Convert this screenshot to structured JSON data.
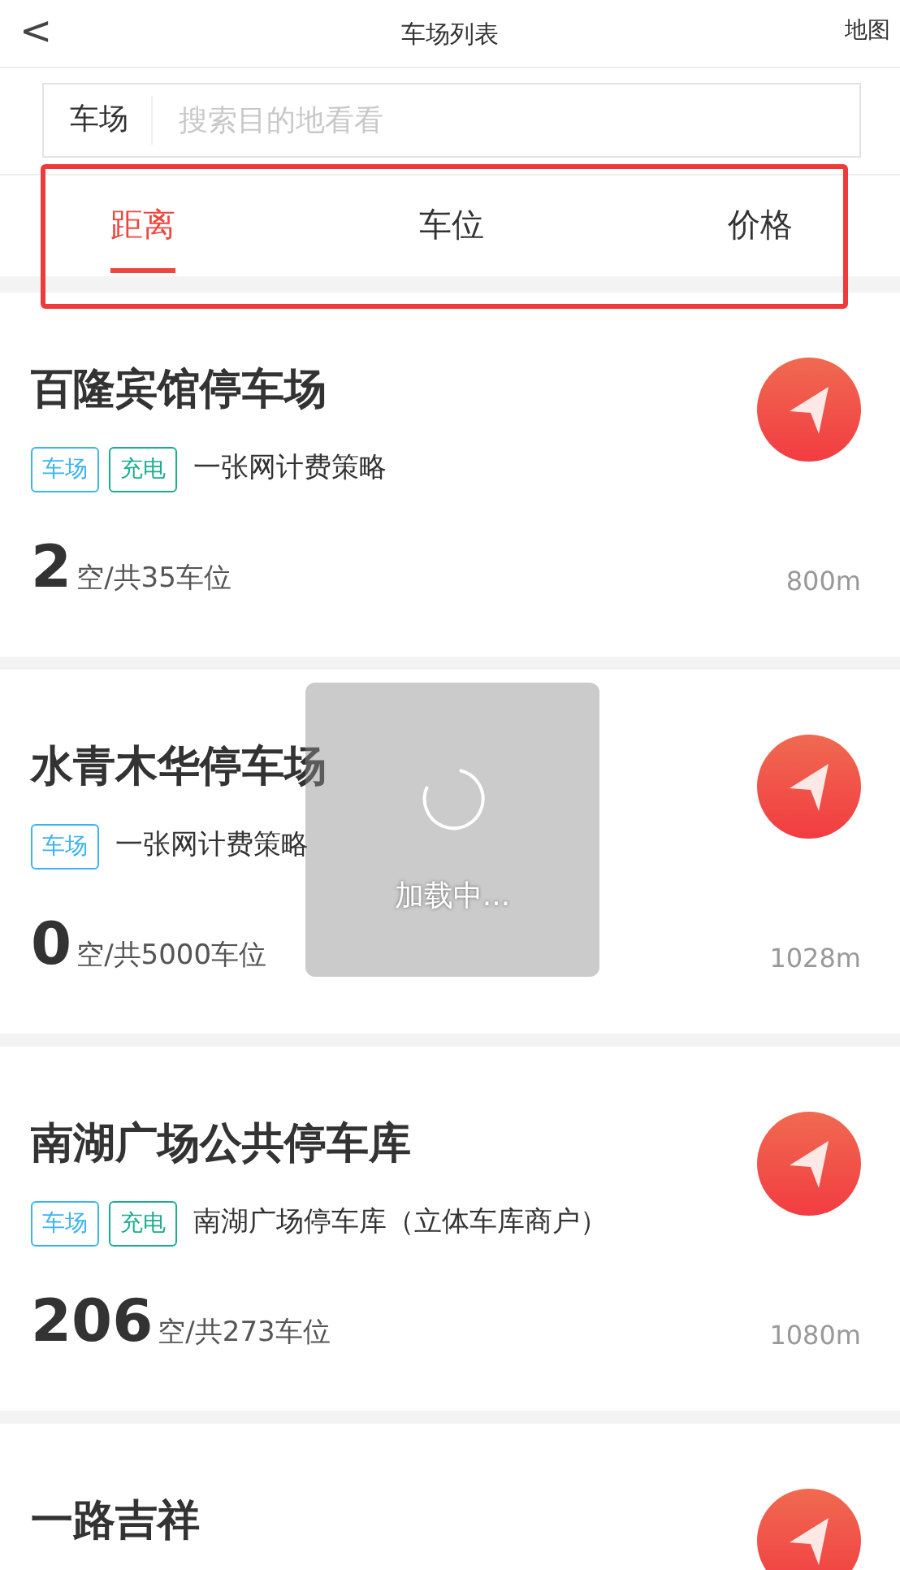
{
  "header": {
    "back": "<",
    "title": "车场列表",
    "action": "地图"
  },
  "search": {
    "label": "车场",
    "placeholder": "搜索目的地看看"
  },
  "tabs": [
    {
      "label": "距离",
      "selected": true
    },
    {
      "label": "车位",
      "selected": false
    },
    {
      "label": "价格",
      "selected": false
    }
  ],
  "tabs_highlighted": true,
  "lots": [
    {
      "name": "百隆宾馆停车场",
      "tags": [
        {
          "label": "车场",
          "color": "#3bb4f2"
        },
        {
          "label": "充电",
          "color": "#1aad8f"
        }
      ],
      "policy": "一张网计费策略",
      "free": "2",
      "total": "空/共35车位",
      "distance": "800m"
    },
    {
      "name": "水青木华停车场",
      "tags": [
        {
          "label": "车场",
          "color": "#3bb4f2"
        }
      ],
      "policy": "一张网计费策略",
      "free": "0",
      "total": "空/共5000车位",
      "distance": "1028m"
    },
    {
      "name": "南湖广场公共停车库",
      "tags": [
        {
          "label": "车场",
          "color": "#3bb4f2"
        },
        {
          "label": "充电",
          "color": "#1aad8f"
        }
      ],
      "policy": "南湖广场停车库（立体车库商户）",
      "free": "206",
      "total": "空/共273车位",
      "distance": "1080m"
    },
    {
      "name": "一路吉祥"
    }
  ],
  "loading": {
    "text": "加载中..."
  }
}
